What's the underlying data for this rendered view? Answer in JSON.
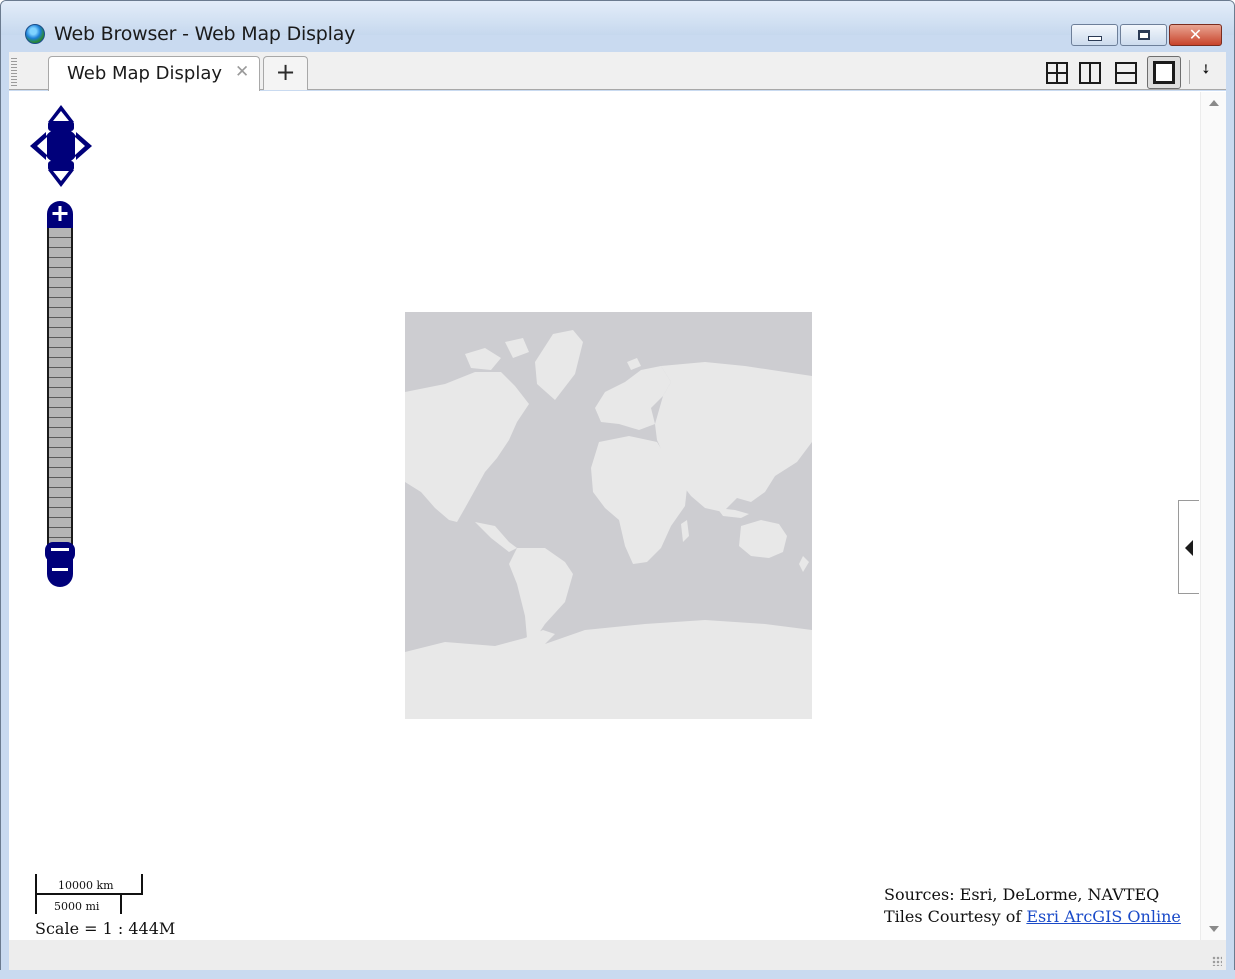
{
  "window": {
    "title": "Web Browser - Web Map Display",
    "icon": "globe-icon",
    "controls": [
      "minimize-icon",
      "maximize-icon",
      "close-icon"
    ]
  },
  "tabs": [
    {
      "label": "Web Map Display",
      "active": true,
      "close_icon": "close-tab-icon"
    }
  ],
  "tabbar": {
    "new_tab_label": "+",
    "layout_buttons": [
      "grid-layout-icon",
      "columns-layout-icon",
      "rows-layout-icon",
      "single-layout-icon"
    ],
    "selected_layout": "single-layout-icon",
    "undock_icon": "undock-icon"
  },
  "map": {
    "navigation": "pan-arrows-icon",
    "zoom_in": "+",
    "zoom_out": "−",
    "zoom_level_fraction": 0.0,
    "scale": {
      "km_label": "10000 km",
      "mi_label": "5000 mi",
      "ratio_label": "Scale = 1 : 444M"
    },
    "attribution": {
      "line1": "Sources: Esri, DeLorme, NAVTEQ",
      "line2_prefix": "Tiles Courtesy of ",
      "line2_link": "Esri ArcGIS Online"
    },
    "colors": {
      "control_fill": "#00007a",
      "ocean": "#cdcdd1",
      "land": "#e8e8e8"
    }
  }
}
